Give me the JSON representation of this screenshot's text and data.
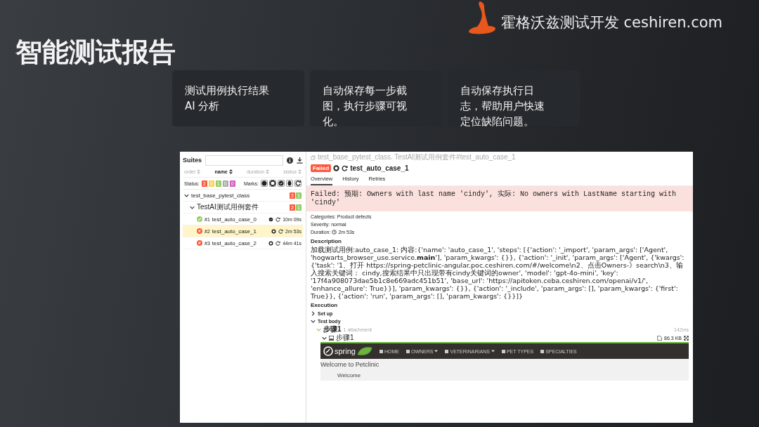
{
  "brand": {
    "text": "霍格沃兹测试开发 ceshiren.com"
  },
  "title": "智能测试报告",
  "cards": [
    {
      "text": "测试用例执行结果 AI 分析"
    },
    {
      "text": "自动保存每一步截图，执行步骤可视化。"
    },
    {
      "text": "自动保存执行日志，帮助用户快速定位缺陷问题。"
    }
  ],
  "report": {
    "suites": {
      "title": "Suites",
      "sort_columns": [
        {
          "label": "order",
          "selected": false
        },
        {
          "label": "name",
          "selected": true
        },
        {
          "label": "duration",
          "selected": false
        },
        {
          "label": "status",
          "selected": false
        }
      ],
      "status_label": "Status:",
      "status_counts": [
        {
          "count": "2",
          "color": "#fd5a3e"
        },
        {
          "count": "0",
          "color": "#ffd050"
        },
        {
          "count": "1",
          "color": "#97cc64"
        },
        {
          "count": "0",
          "color": "#aaaaaa"
        },
        {
          "count": "0",
          "color": "#d35ebe"
        }
      ],
      "marks_label": "Marks:",
      "tree": [
        {
          "name": "test_base_pytest_class",
          "expanded": true,
          "counts": [
            {
              "count": "2",
              "color": "#fd5a3e"
            },
            {
              "count": "1",
              "color": "#97cc64"
            }
          ],
          "children": [
            {
              "name": "TestAI测试用例套件",
              "expanded": true,
              "counts": [
                {
                  "count": "2",
                  "color": "#fd5a3e"
                },
                {
                  "count": "1",
                  "color": "#97cc64"
                }
              ],
              "tests": [
                {
                  "order": "#1",
                  "name": "test_auto_case_0",
                  "kind": "passed",
                  "selected": false,
                  "duration": "10m 09s"
                },
                {
                  "order": "#2",
                  "name": "test_auto_case_1",
                  "kind": "failed",
                  "selected": true,
                  "duration": "2m 53s"
                },
                {
                  "order": "#3",
                  "name": "test_auto_case_2",
                  "kind": "failed",
                  "selected": false,
                  "duration": "44m 41s"
                }
              ]
            }
          ]
        }
      ]
    },
    "detail": {
      "breadcrumb": "test_base_pytest_class. TestAI测试用例套件#test_auto_case_1",
      "status_badge": "Failed",
      "test_name": "test_auto_case_1",
      "tabs": [
        {
          "label": "Overview",
          "selected": true
        },
        {
          "label": "History",
          "selected": false
        },
        {
          "label": "Retries",
          "selected": false
        }
      ],
      "error": "Failed: 预期: Owners with last name 'cindy', 实际: No owners with LastName starting with 'cindy'",
      "fields": [
        {
          "text": "Categories: Product defects"
        },
        {
          "text": "Severity: normal"
        }
      ],
      "duration": {
        "label": "Duration:",
        "value": "2m 53s"
      },
      "description_heading": "Description",
      "description": "加载测试用例:auto_case_1: 内容:{'name': 'auto_case_1', 'steps': [{'action': '_import', 'param_args': ['Agent', 'hogwarts_browser_use.service.**main**'], 'param_kwargs': {}}, {'action': '_init', 'param_args': ['Agent', {'kwargs': {'task': '1、打开 https://spring-petclinic-angular.poc.ceshiren.com/#/welcome\\n2、点击Owners-》search\\n3、输入搜索关键词：  cindy,搜索结果中只出现带有cindy关键词的owner', 'model': 'gpt-4o-mini', 'key': '17f4a908073dae5b1c8e669adc451b51', 'base_url': 'https://apitoken.ceba.ceshiren.com/openai/v1/', 'enhance_allure': True}}], 'param_kwargs': {}}, {'action': '_include', 'param_args': [], 'param_kwargs': {'first': True}}, {'action': 'run', 'param_args': [], 'param_kwargs': {}}]}",
      "execution_heading": "Execution",
      "sections": [
        {
          "label": "Set up",
          "expanded": false
        },
        {
          "label": "Test body",
          "expanded": true
        }
      ],
      "step": {
        "label": "步骤1",
        "attachments": "1 attachment",
        "time": "142ms",
        "expanded": true
      },
      "attachment": {
        "label": "步骤1",
        "size": "86.3 KB",
        "expanded": true
      },
      "screenshot": {
        "logo": "spring",
        "nav": [
          {
            "label": "HOME",
            "dropdown": false
          },
          {
            "label": "OWNERS",
            "dropdown": true
          },
          {
            "label": "VETERINARIANS",
            "dropdown": true
          },
          {
            "label": "PET TYPES",
            "dropdown": false
          },
          {
            "label": "SPECIALTIES",
            "dropdown": false
          }
        ],
        "heading": "Welcome to Petclinic",
        "subheading": "Welcome"
      }
    }
  }
}
